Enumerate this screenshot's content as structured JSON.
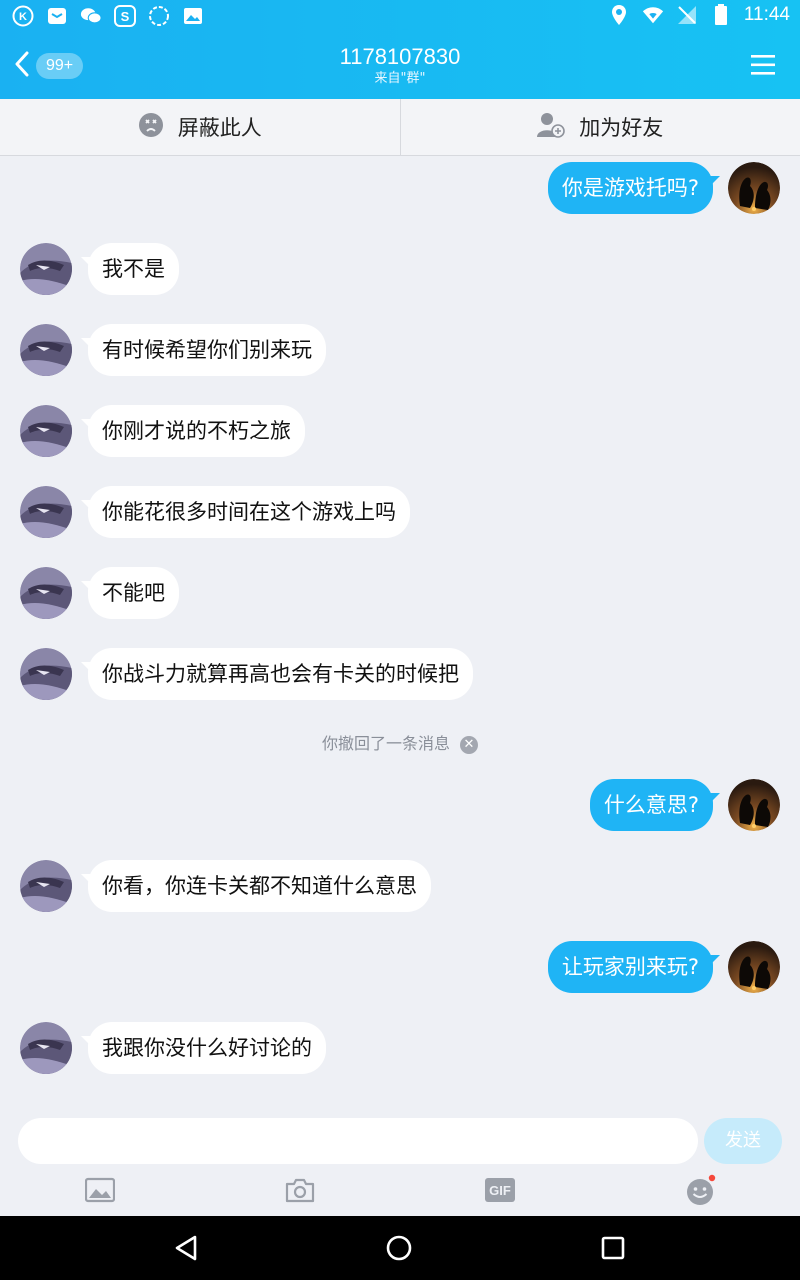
{
  "status_bar": {
    "time": "11:44",
    "left_icons": [
      "kugou-icon",
      "mail-icon",
      "wechat-icon",
      "app-s-icon",
      "loading-circle-icon",
      "gallery-icon"
    ],
    "right_icons": [
      "location-icon",
      "wifi-icon",
      "no-sim-icon",
      "battery-icon"
    ]
  },
  "header": {
    "unread_badge": "99+",
    "title": "1178107830",
    "subtitle": "来自\"群\""
  },
  "actions": {
    "block_label": "屏蔽此人",
    "add_friend_label": "加为好友"
  },
  "messages": [
    {
      "from": "me",
      "text": "你是游戏托吗?"
    },
    {
      "from": "other",
      "text": "我不是"
    },
    {
      "from": "other",
      "text": "有时候希望你们别来玩"
    },
    {
      "from": "other",
      "text": "你刚才说的不朽之旅"
    },
    {
      "from": "other",
      "text": "你能花很多时间在这个游戏上吗"
    },
    {
      "from": "other",
      "text": "不能吧"
    },
    {
      "from": "other",
      "text": "你战斗力就算再高也会有卡关的时候把"
    },
    {
      "from": "system",
      "text": "你撤回了一条消息"
    },
    {
      "from": "me",
      "text": "什么意思?"
    },
    {
      "from": "other",
      "text": "你看，你连卡关都不知道什么意思"
    },
    {
      "from": "me",
      "text": "让玩家别来玩?"
    },
    {
      "from": "other",
      "text": "我跟你没什么好讨论的"
    }
  ],
  "input": {
    "value": "",
    "send_label": "发送"
  },
  "toolbar": {
    "gif_label": "GIF"
  },
  "colors": {
    "accent": "#1fb4f5",
    "notification_dot": "#f5483b"
  }
}
